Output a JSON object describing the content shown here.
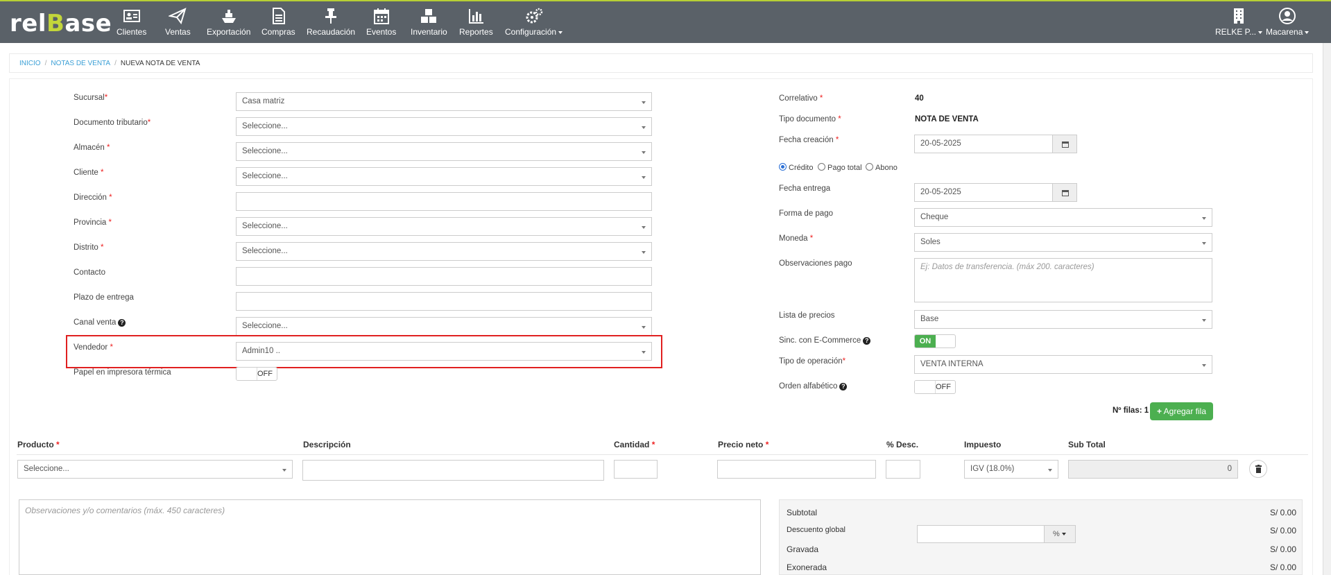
{
  "app": {
    "logo_a": "rel",
    "logo_b": "B",
    "logo_c": "ase"
  },
  "nav": {
    "items": [
      {
        "label": "Clientes",
        "icon": "id-card-icon"
      },
      {
        "label": "Ventas",
        "icon": "paper-plane-icon"
      },
      {
        "label": "Exportación",
        "icon": "ship-icon"
      },
      {
        "label": "Compras",
        "icon": "document-icon"
      },
      {
        "label": "Recaudación",
        "icon": "pin-icon"
      },
      {
        "label": "Eventos",
        "icon": "calendar-icon"
      },
      {
        "label": "Inventario",
        "icon": "cubes-icon"
      },
      {
        "label": "Reportes",
        "icon": "bar-chart-icon"
      },
      {
        "label": "Configuración",
        "icon": "gears-icon"
      }
    ],
    "company": "RELKE P...",
    "user": "Macarena"
  },
  "breadcrumb": {
    "home": "INICIO",
    "list": "NOTAS DE VENTA",
    "current": "NUEVA NOTA DE VENTA"
  },
  "left_form": {
    "sucursal": {
      "label": "Sucursal",
      "value": "Casa matriz"
    },
    "documento": {
      "label": "Documento tributario",
      "value": "Seleccione..."
    },
    "almacen": {
      "label": "Almacén",
      "value": "Seleccione..."
    },
    "cliente": {
      "label": "Cliente",
      "value": "Seleccione..."
    },
    "direccion": {
      "label": "Dirección",
      "value": ""
    },
    "provincia": {
      "label": "Provincia",
      "value": "Seleccione..."
    },
    "distrito": {
      "label": "Distrito",
      "value": "Seleccione..."
    },
    "contacto": {
      "label": "Contacto",
      "value": ""
    },
    "plazo": {
      "label": "Plazo de entrega",
      "value": ""
    },
    "canal": {
      "label": "Canal venta",
      "value": "Seleccione..."
    },
    "vendedor": {
      "label": "Vendedor",
      "value": "Admin10 .."
    },
    "papel": {
      "label": "Papel en impresora térmica",
      "state": "OFF"
    }
  },
  "right_form": {
    "correlativo": {
      "label": "Correlativo",
      "value": "40"
    },
    "tipo_doc": {
      "label": "Tipo documento",
      "value": "NOTA DE VENTA"
    },
    "fecha_creacion": {
      "label": "Fecha creación",
      "value": "20-05-2025"
    },
    "pago_opts": {
      "credito": "Crédito",
      "pago_total": "Pago total",
      "abono": "Abono",
      "selected": "Crédito"
    },
    "fecha_entrega": {
      "label": "Fecha entrega",
      "value": "20-05-2025"
    },
    "forma_pago": {
      "label": "Forma de pago",
      "value": "Cheque"
    },
    "moneda": {
      "label": "Moneda",
      "value": "Soles"
    },
    "obs_pago": {
      "label": "Observaciones pago",
      "placeholder": "Ej: Datos de transferencia. (máx 200. caracteres)"
    },
    "lista_precios": {
      "label": "Lista de precios",
      "value": "Base"
    },
    "sinc": {
      "label": "Sinc. con E-Commerce",
      "state": "ON"
    },
    "tipo_operacion": {
      "label": "Tipo de operación",
      "value": "VENTA INTERNA"
    },
    "orden": {
      "label": "Orden alfabético",
      "state": "OFF"
    }
  },
  "rows": {
    "label": "Nº filas:",
    "count": "1",
    "add_button": "Agregar fila"
  },
  "table": {
    "headers": {
      "producto": "Producto",
      "descripcion": "Descripción",
      "cantidad": "Cantidad",
      "precio": "Precio neto",
      "desc": "% Desc.",
      "impuesto": "Impuesto",
      "subtotal": "Sub Total"
    },
    "row": {
      "producto": "Seleccione...",
      "impuesto": "IGV (18.0%)",
      "subtotal": "0"
    }
  },
  "comments": {
    "placeholder": "Observaciones y/o comentarios (máx. 450 caracteres)"
  },
  "totals": {
    "subtotal": {
      "label": "Subtotal",
      "value": "S/ 0.00"
    },
    "descuento": {
      "label": "Descuento global",
      "value": "S/ 0.00",
      "unit": "%"
    },
    "gravada": {
      "label": "Gravada",
      "value": "S/ 0.00"
    },
    "exonerada": {
      "label": "Exonerada",
      "value": "S/ 0.00"
    }
  },
  "colors": {
    "navbar": "#5a6168",
    "accent": "#b7cf35",
    "link": "#3a9fd6",
    "success": "#4caf50",
    "required": "#e22222",
    "highlight": "#e02020"
  }
}
